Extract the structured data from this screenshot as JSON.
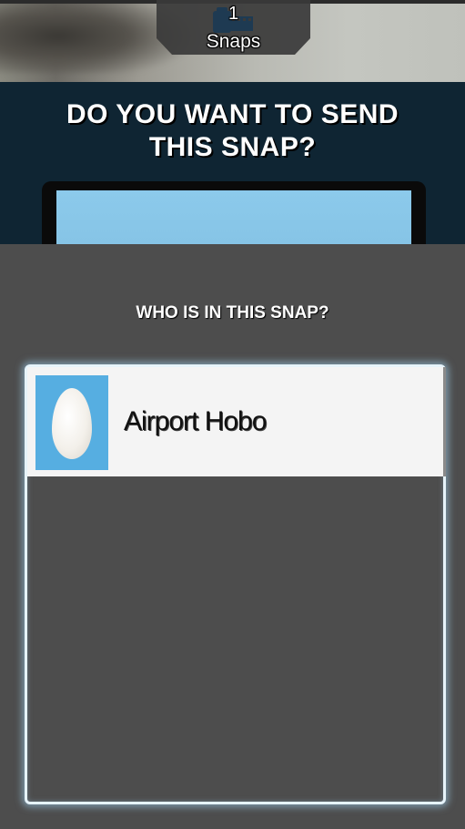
{
  "top_bar": {
    "snap_count": "1",
    "snap_label": "Snaps",
    "film_icon": "film-roll-icon"
  },
  "send_prompt": {
    "title_line1": "DO YOU WANT TO SEND",
    "title_line2": "THIS SNAP?"
  },
  "tagging": {
    "heading": "WHO IS IN THIS SNAP?",
    "people": [
      {
        "name": "Airport Hobo",
        "avatar_icon": "egg-avatar-icon"
      }
    ]
  },
  "colors": {
    "send_panel_bg": "#0f2533",
    "lower_panel_bg": "#4d4d4d",
    "list_glow": "#e6f3fa",
    "avatar_bg": "#56aee1",
    "row_bg": "#f4f4f4"
  }
}
